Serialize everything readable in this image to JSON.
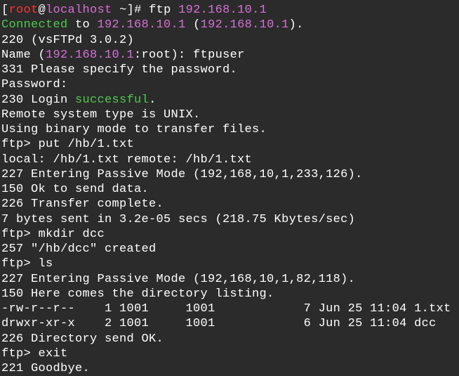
{
  "prompt": {
    "lbracket": "[",
    "user": "root",
    "at": "@",
    "host": "localhost",
    "tilde": " ~",
    "rbracket": "]# ",
    "cmd": "ftp ",
    "ip": "192.168.10.1"
  },
  "l1": {
    "a": "Connected",
    "b": " to ",
    "c": "192.168.10.1",
    "d": " (",
    "e": "192.168.10.1",
    "f": ")."
  },
  "l2": "220 (vsFTPd 3.0.2)",
  "l3": {
    "a": "Name (",
    "b": "192.168.10.1",
    "c": ":root): ftpuser"
  },
  "l4": "331 Please specify the password.",
  "l5": "Password:",
  "l6": {
    "a": "230 Login ",
    "b": "successful",
    "c": "."
  },
  "l7": "Remote system type is UNIX.",
  "l8": "Using binary mode to transfer files.",
  "l9": "ftp> put /hb/1.txt",
  "l10": "local: /hb/1.txt remote: /hb/1.txt",
  "l11": "227 Entering Passive Mode (192,168,10,1,233,126).",
  "l12": "150 Ok to send data.",
  "l13": "226 Transfer complete.",
  "l14": "7 bytes sent in 3.2e-05 secs (218.75 Kbytes/sec)",
  "l15": "ftp> mkdir dcc",
  "l16": "257 \"/hb/dcc\" created",
  "l17": "ftp> ls",
  "l18": "227 Entering Passive Mode (192,168,10,1,82,118).",
  "l19": "150 Here comes the directory listing.",
  "l20": "-rw-r--r--    1 1001     1001            7 Jun 25 11:04 1.txt",
  "l21": "drwxr-xr-x    2 1001     1001            6 Jun 25 11:04 dcc",
  "l22": "226 Directory send OK.",
  "l23": "ftp> exit",
  "l24": "221 Goodbye."
}
